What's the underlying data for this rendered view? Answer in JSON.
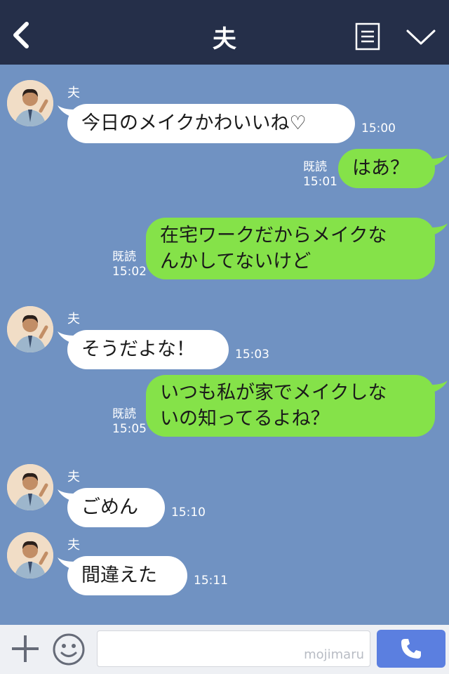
{
  "header": {
    "title": "夫",
    "icons": [
      "back-icon",
      "notes-icon",
      "chevron-down-icon"
    ]
  },
  "messages": [
    {
      "side": "in",
      "sender": "夫",
      "lines": [
        "今日のメイクかわいいね♡"
      ],
      "time": "15:00"
    },
    {
      "side": "out",
      "read": "既読",
      "lines": [
        "はあ？"
      ],
      "time": "15:01"
    },
    {
      "side": "out",
      "read": "既読",
      "lines": [
        "在宅ワークだからメイクな",
        "んかしてないけど"
      ],
      "time": "15:02"
    },
    {
      "side": "in",
      "sender": "夫",
      "lines": [
        "そうだよな！"
      ],
      "time": "15:03"
    },
    {
      "side": "out",
      "read": "既読",
      "lines": [
        "いつも私が家でメイクしな",
        "いの知ってるよね？"
      ],
      "time": "15:05"
    },
    {
      "side": "in",
      "sender": "夫",
      "lines": [
        "ごめん"
      ],
      "time": "15:10"
    },
    {
      "side": "in",
      "sender": "夫",
      "lines": [
        "間違えた"
      ],
      "time": "15:11"
    }
  ],
  "input_bar": {
    "watermark": "mojimaru",
    "icons": [
      "plus-icon",
      "smile-icon",
      "phone-icon"
    ]
  },
  "colors": {
    "header_bg": "#252f49",
    "chat_bg": "#7092c2",
    "incoming_bubble": "#ffffff",
    "outgoing_bubble": "#85e249",
    "call_button": "#5b7fe0"
  }
}
